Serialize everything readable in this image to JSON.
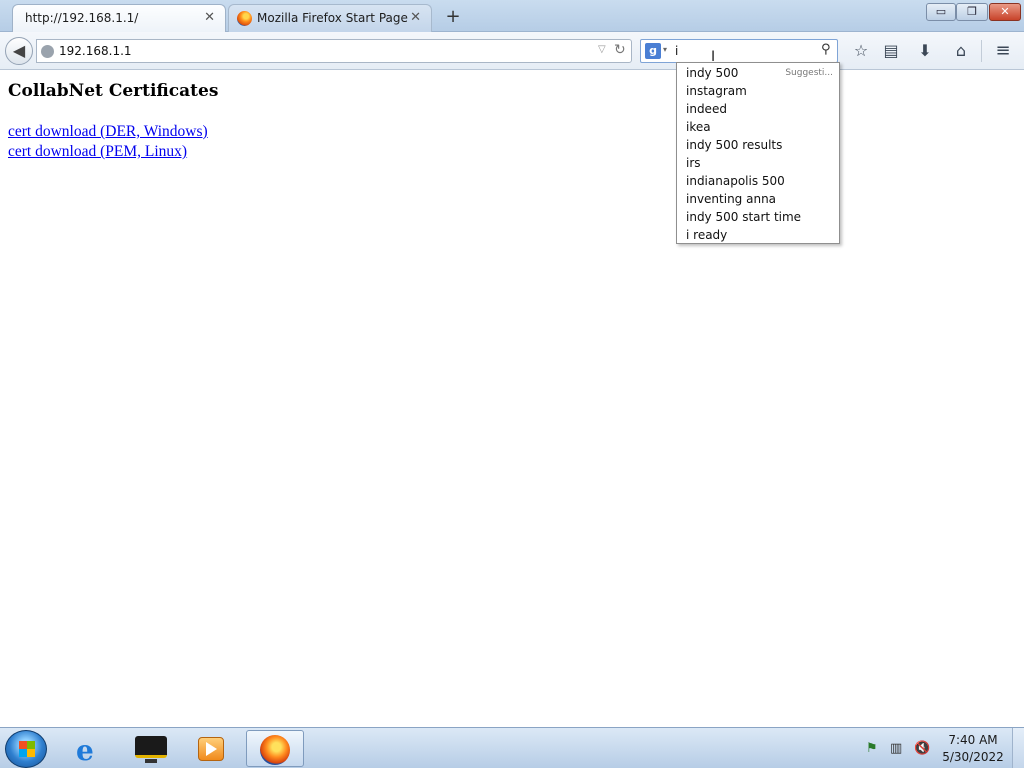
{
  "window": {
    "controls": {
      "minimize": "▭",
      "maximize": "❐",
      "close": "✕"
    }
  },
  "tabs": [
    {
      "title": "http://192.168.1.1/",
      "active": true,
      "close": "✕"
    },
    {
      "title": "Mozilla Firefox Start Page",
      "active": false,
      "close": "✕"
    }
  ],
  "new_tab_label": "+",
  "navbar": {
    "back": "◀",
    "url": "192.168.1.1",
    "url_dropmarker": "▽",
    "reload": "↻",
    "search_engine_glyph": "g",
    "search_engine_dropdown": "▾",
    "search_value": "i",
    "search_go": "⚲",
    "icons": {
      "bookmark": "☆",
      "reading_list": "▤",
      "downloads": "⬇",
      "home": "⌂",
      "menu": "≡"
    }
  },
  "page": {
    "heading": "CollabNet Certificates",
    "links": [
      "cert download (DER, Windows)",
      "cert download (PEM, Linux)"
    ]
  },
  "suggestions": {
    "hint": "Suggesti...",
    "items": [
      "indy 500",
      "instagram",
      "indeed",
      "ikea",
      "indy 500 results",
      "irs",
      "indianapolis 500",
      "inventing anna",
      "indy 500 start time",
      "i ready"
    ]
  },
  "mouse_cursor": "I",
  "taskbar": {
    "ie_glyph": "e",
    "tray": {
      "flag": "⚑",
      "network": "▥",
      "volume": "🔇"
    },
    "clock_time": "7:40 AM",
    "clock_date": "5/30/2022"
  },
  "colors": {
    "link": "#0000ee",
    "search_border": "#7fa4d6",
    "taskbar": "#b7cde6"
  }
}
